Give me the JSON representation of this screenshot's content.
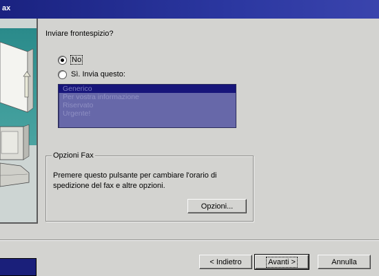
{
  "title_bar": {
    "title": "ax"
  },
  "wizard": {
    "question": "Inviare frontespizio?",
    "options": [
      {
        "label": "No",
        "selected": true
      },
      {
        "label": "Sì. Invia questo:",
        "selected": false
      }
    ],
    "cover_pages": [
      "Generico",
      "Per vostra informazione",
      "Riservato",
      "Urgente!"
    ],
    "selected_cover_page": "Generico"
  },
  "fax_options": {
    "legend": "Opzioni Fax",
    "description": "Premere questo pulsante per cambiare l'orario di spedizione del fax e altre opzioni.",
    "button_label": "Opzioni..."
  },
  "navigation": {
    "back_label": "< Indietro",
    "next_label": "Avanti >",
    "cancel_label": "Annulla"
  },
  "colors": {
    "title_bar": "#1a2280",
    "list_background": "#6768a9",
    "list_selection": "#17157a",
    "dialog_face": "#d3d3d0",
    "graphic_teal": "#2a8a8a"
  }
}
